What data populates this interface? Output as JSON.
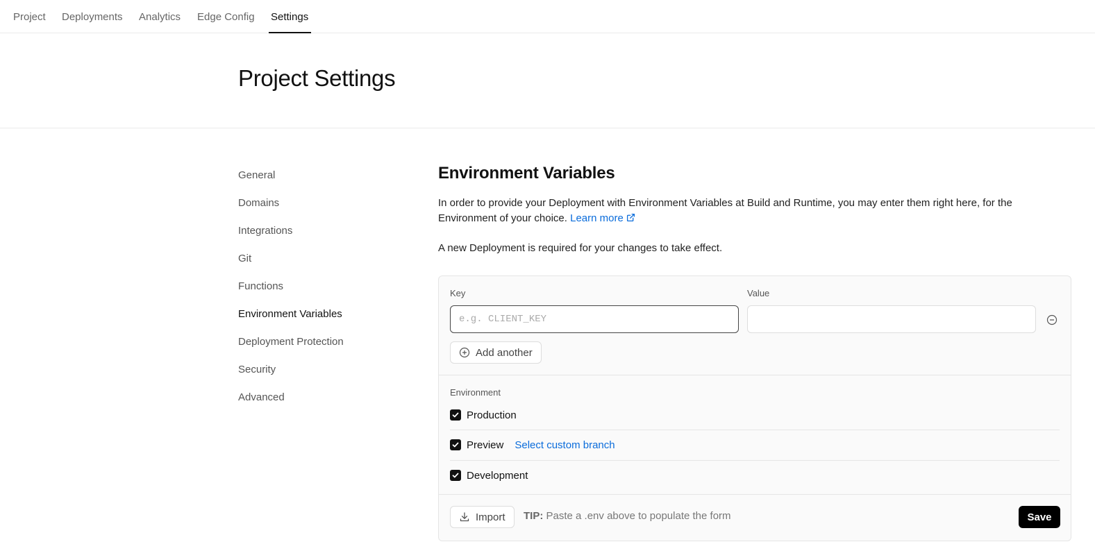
{
  "topnav": {
    "tabs": [
      {
        "label": "Project"
      },
      {
        "label": "Deployments"
      },
      {
        "label": "Analytics"
      },
      {
        "label": "Edge Config"
      },
      {
        "label": "Settings",
        "active": true
      }
    ]
  },
  "header": {
    "title": "Project Settings"
  },
  "sidebar": {
    "items": [
      {
        "label": "General"
      },
      {
        "label": "Domains"
      },
      {
        "label": "Integrations"
      },
      {
        "label": "Git"
      },
      {
        "label": "Functions"
      },
      {
        "label": "Environment Variables",
        "active": true
      },
      {
        "label": "Deployment Protection"
      },
      {
        "label": "Security"
      },
      {
        "label": "Advanced"
      }
    ]
  },
  "main": {
    "title": "Environment Variables",
    "description": "In order to provide your Deployment with Environment Variables at Build and Runtime, you may enter them right here, for the Environment of your choice.",
    "learn_more": "Learn more",
    "note": "A new Deployment is required for your changes to take effect.",
    "form": {
      "key_label": "Key",
      "key_placeholder": "e.g. CLIENT_KEY",
      "key_value": "",
      "value_label": "Value",
      "value_value": "",
      "add_another": "Add another",
      "environment_label": "Environment",
      "environments": [
        {
          "label": "Production",
          "checked": true
        },
        {
          "label": "Preview",
          "checked": true,
          "link": "Select custom branch"
        },
        {
          "label": "Development",
          "checked": true
        }
      ],
      "import_label": "Import",
      "tip_prefix": "TIP:",
      "tip_text": "Paste a .env above to populate the form",
      "save_label": "Save"
    }
  },
  "colors": {
    "accent_link": "#0a6cdb",
    "primary_button": "#000000"
  }
}
